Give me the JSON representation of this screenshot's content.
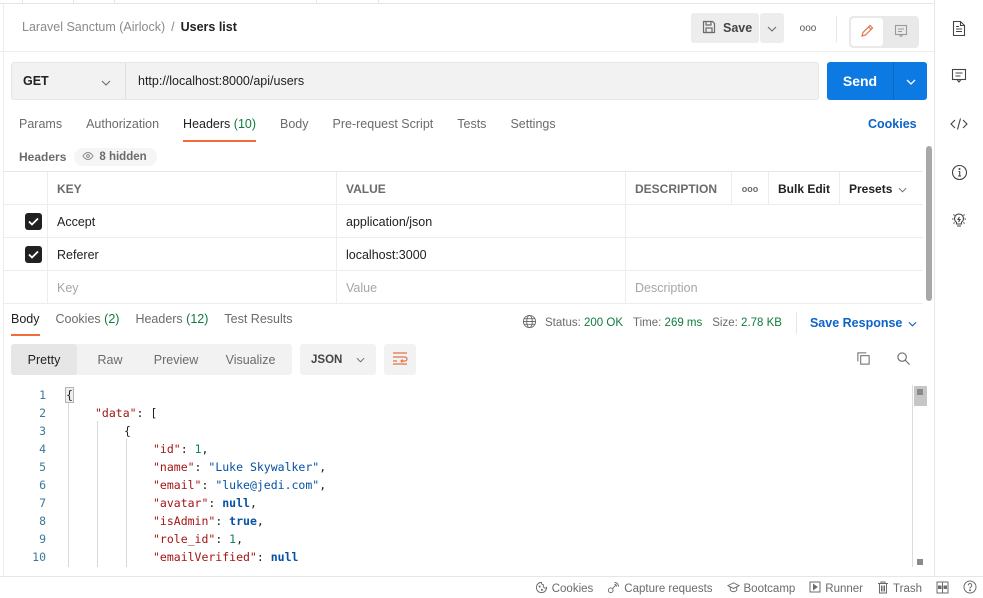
{
  "breadcrumb": {
    "parent": "Laravel Sanctum (Airlock)",
    "separator": "/",
    "current": "Users list"
  },
  "toolbar": {
    "save_label": "Save",
    "more_label": "ooo"
  },
  "request": {
    "method": "GET",
    "url": "http://localhost:8000/api/users",
    "send_label": "Send"
  },
  "request_tabs": [
    {
      "label": "Params"
    },
    {
      "label": "Authorization"
    },
    {
      "label": "Headers",
      "count": "(10)",
      "active": true
    },
    {
      "label": "Body"
    },
    {
      "label": "Pre-request Script"
    },
    {
      "label": "Tests"
    },
    {
      "label": "Settings"
    }
  ],
  "cookies_link": "Cookies",
  "headers_section": {
    "title": "Headers",
    "hidden_label": "8 hidden"
  },
  "headers_table": {
    "columns": {
      "key": "KEY",
      "value": "VALUE",
      "description": "DESCRIPTION",
      "more": "ooo",
      "bulk_edit": "Bulk Edit",
      "presets": "Presets"
    },
    "rows": [
      {
        "checked": true,
        "key": "Accept",
        "value": "application/json",
        "description": ""
      },
      {
        "checked": true,
        "key": "Referer",
        "value": "localhost:3000",
        "description": ""
      }
    ],
    "placeholders": {
      "key": "Key",
      "value": "Value",
      "description": "Description"
    }
  },
  "response_tabs": [
    {
      "label": "Body",
      "active": true
    },
    {
      "label": "Cookies",
      "count": "(2)"
    },
    {
      "label": "Headers",
      "count": "(12)"
    },
    {
      "label": "Test Results"
    }
  ],
  "response_meta": {
    "status_label": "Status:",
    "status": "200 OK",
    "time_label": "Time:",
    "time": "269 ms",
    "size_label": "Size:",
    "size": "2.78 KB",
    "save_response": "Save Response"
  },
  "view_modes": [
    {
      "label": "Pretty",
      "active": true
    },
    {
      "label": "Raw"
    },
    {
      "label": "Preview"
    },
    {
      "label": "Visualize"
    }
  ],
  "format": "JSON",
  "code_lines": [
    {
      "n": "1",
      "indent": 0,
      "tokens": [
        [
          "p",
          "{"
        ]
      ]
    },
    {
      "n": "2",
      "indent": 1,
      "tokens": [
        [
          "k",
          "\"data\""
        ],
        [
          "p",
          ": ["
        ]
      ]
    },
    {
      "n": "3",
      "indent": 2,
      "tokens": [
        [
          "p",
          "{"
        ]
      ]
    },
    {
      "n": "4",
      "indent": 3,
      "tokens": [
        [
          "k",
          "\"id\""
        ],
        [
          "p",
          ": "
        ],
        [
          "n",
          "1"
        ],
        [
          "p",
          ","
        ]
      ]
    },
    {
      "n": "5",
      "indent": 3,
      "tokens": [
        [
          "k",
          "\"name\""
        ],
        [
          "p",
          ": "
        ],
        [
          "s",
          "\"Luke Skywalker\""
        ],
        [
          "p",
          ","
        ]
      ]
    },
    {
      "n": "6",
      "indent": 3,
      "tokens": [
        [
          "k",
          "\"email\""
        ],
        [
          "p",
          ": "
        ],
        [
          "s",
          "\"luke@jedi.com\""
        ],
        [
          "p",
          ","
        ]
      ]
    },
    {
      "n": "7",
      "indent": 3,
      "tokens": [
        [
          "k",
          "\"avatar\""
        ],
        [
          "p",
          ": "
        ],
        [
          "b",
          "null"
        ],
        [
          "p",
          ","
        ]
      ]
    },
    {
      "n": "8",
      "indent": 3,
      "tokens": [
        [
          "k",
          "\"isAdmin\""
        ],
        [
          "p",
          ": "
        ],
        [
          "b",
          "true"
        ],
        [
          "p",
          ","
        ]
      ]
    },
    {
      "n": "9",
      "indent": 3,
      "tokens": [
        [
          "k",
          "\"role_id\""
        ],
        [
          "p",
          ": "
        ],
        [
          "n",
          "1"
        ],
        [
          "p",
          ","
        ]
      ]
    },
    {
      "n": "10",
      "indent": 3,
      "tokens": [
        [
          "k",
          "\"emailVerified\""
        ],
        [
          "p",
          ": "
        ],
        [
          "b",
          "null"
        ]
      ]
    }
  ],
  "statusbar": [
    {
      "icon": "cookie-icon",
      "label": "Cookies"
    },
    {
      "icon": "capture-icon",
      "label": "Capture requests"
    },
    {
      "icon": "bootcamp-icon",
      "label": "Bootcamp"
    },
    {
      "icon": "runner-icon",
      "label": "Runner"
    },
    {
      "icon": "trash-icon",
      "label": "Trash"
    }
  ],
  "right_sidebar": [
    "documentation-icon",
    "comments-icon",
    "code-icon",
    "info-icon",
    "lightbulb-icon"
  ],
  "colors": {
    "send": "#0c7ae2",
    "accent": "#f26b3a",
    "link": "#0c63c8",
    "success": "#0f7b3e"
  }
}
